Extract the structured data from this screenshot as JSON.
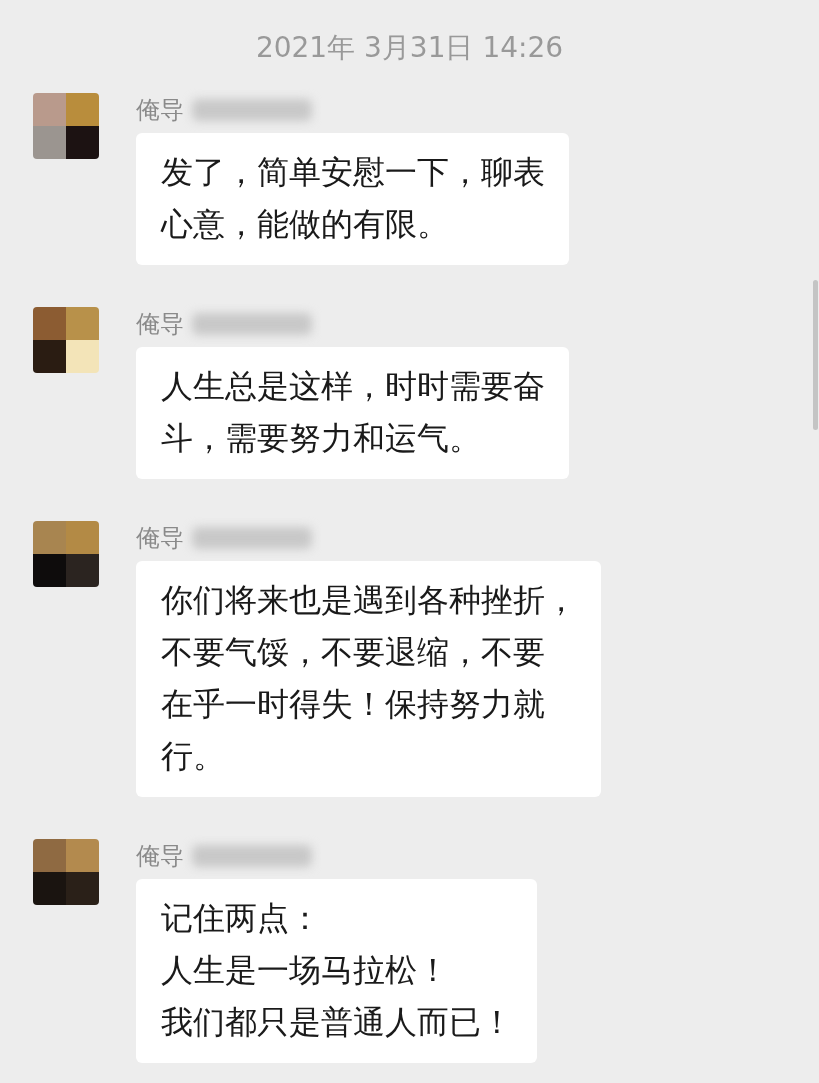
{
  "timestamp": "2021年 3月31日 14:26",
  "messages": [
    {
      "sender": "俺导",
      "lines": [
        "发了，简单安慰一下，聊表",
        "心意，能做的有限。"
      ]
    },
    {
      "sender": "俺导",
      "lines": [
        "人生总是这样，时时需要奋",
        "斗，需要努力和运气。"
      ]
    },
    {
      "sender": "俺导",
      "lines": [
        "你们将来也是遇到各种挫折，",
        "不要气馁，不要退缩，不要",
        "在乎一时得失！保持努力就",
        "行。"
      ]
    },
    {
      "sender": "俺导",
      "lines": [
        "记住两点：",
        "人生是一场马拉松！",
        "我们都只是普通人而已！"
      ]
    }
  ]
}
